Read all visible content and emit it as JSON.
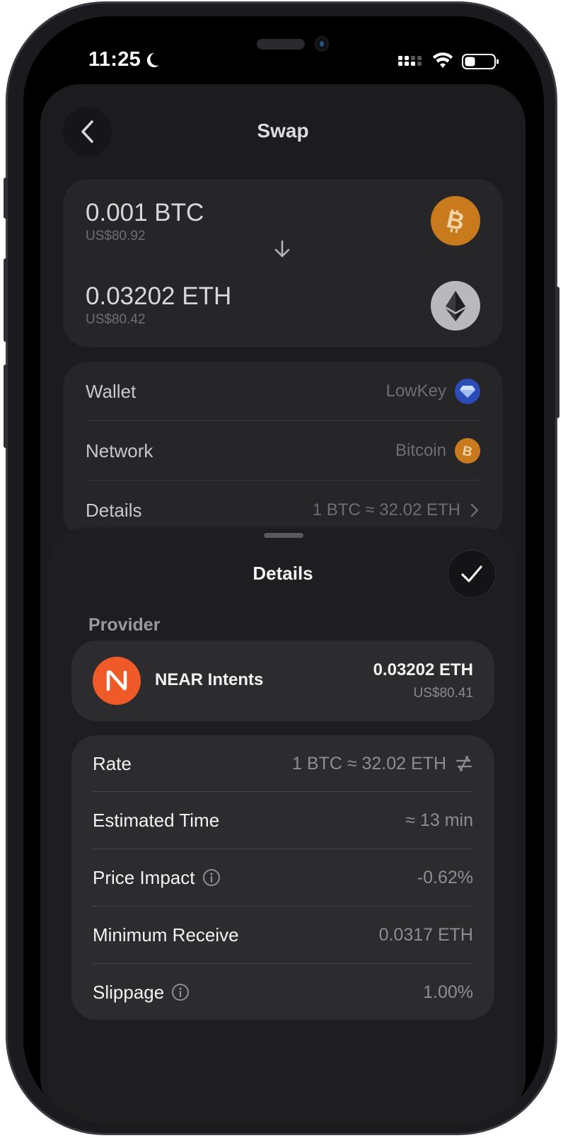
{
  "status_bar": {
    "time": "11:25"
  },
  "header": {
    "title": "Swap"
  },
  "swap": {
    "from": {
      "amount": "0.001 BTC",
      "fiat": "US$80.92",
      "coin_icon": "bitcoin-icon",
      "color": "#c87a1c"
    },
    "to": {
      "amount": "0.03202 ETH",
      "fiat": "US$80.42",
      "coin_icon": "ethereum-icon",
      "color": "#b9b9bc"
    }
  },
  "info": {
    "wallet": {
      "label": "Wallet",
      "value": "LowKey"
    },
    "network": {
      "label": "Network",
      "value": "Bitcoin"
    },
    "details": {
      "label": "Details",
      "value": "1 BTC ≈ 32.02 ETH"
    }
  },
  "sheet": {
    "title": "Details",
    "provider_section": "Provider",
    "provider": {
      "name": "NEAR Intents",
      "amount": "0.03202 ETH",
      "fiat": "US$80.41",
      "color": "#f05a28"
    },
    "rows": {
      "rate": {
        "label": "Rate",
        "value": "1 BTC ≈ 32.02 ETH"
      },
      "estimated_time": {
        "label": "Estimated Time",
        "value": "≈ 13 min"
      },
      "price_impact": {
        "label": "Price Impact",
        "value": "-0.62%"
      },
      "minimum_receive": {
        "label": "Minimum Receive",
        "value": "0.0317 ETH"
      },
      "slippage": {
        "label": "Slippage",
        "value": "1.00%"
      }
    }
  }
}
